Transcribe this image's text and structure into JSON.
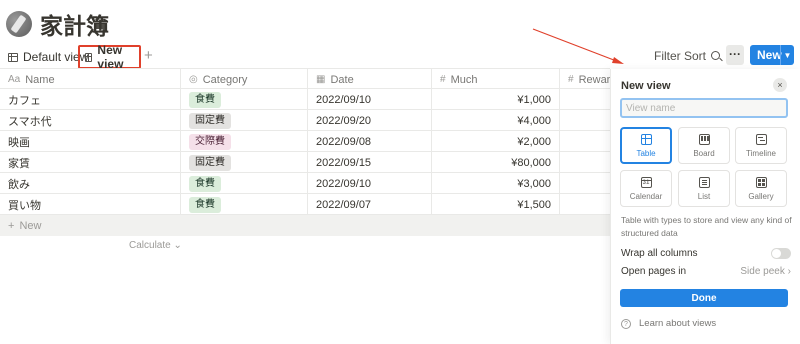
{
  "page": {
    "title": "家計簿"
  },
  "views": {
    "tabs": [
      {
        "label": "Default view"
      },
      {
        "label": "New view"
      }
    ],
    "filter_label": "Filter",
    "sort_label": "Sort",
    "more_label": "···",
    "new_label": "New"
  },
  "table": {
    "columns": [
      {
        "icon": "Aa",
        "label": "Name"
      },
      {
        "icon": "◎",
        "label": "Category"
      },
      {
        "icon": "▦",
        "label": "Date"
      },
      {
        "icon": "#",
        "label": "Much"
      },
      {
        "icon": "#",
        "label": "Reward"
      }
    ],
    "rows": [
      {
        "name": "カフェ",
        "category": "食費",
        "category_color": "#dbeddb",
        "date": "2022/09/10",
        "much": "¥1,000"
      },
      {
        "name": "スマホ代",
        "category": "固定費",
        "category_color": "#e3e2e0",
        "date": "2022/09/20",
        "much": "¥4,000"
      },
      {
        "name": "映画",
        "category": "交際費",
        "category_color": "#f5e0e9",
        "date": "2022/09/08",
        "much": "¥2,000"
      },
      {
        "name": "家賃",
        "category": "固定費",
        "category_color": "#e3e2e0",
        "date": "2022/09/15",
        "much": "¥80,000"
      },
      {
        "name": "飲み",
        "category": "食費",
        "category_color": "#dbeddb",
        "date": "2022/09/10",
        "much": "¥3,000"
      },
      {
        "name": "買い物",
        "category": "食費",
        "category_color": "#dbeddb",
        "date": "2022/09/07",
        "much": "¥1,500"
      }
    ],
    "new_row_label": "New",
    "calculate_label": "Calculate"
  },
  "new_view_panel": {
    "title": "New view",
    "close_icon": "×",
    "name_placeholder": "View name",
    "layouts": [
      {
        "label": "Table",
        "icon": "table-icon",
        "selected": true
      },
      {
        "label": "Board",
        "icon": "board-icon",
        "selected": false
      },
      {
        "label": "Timeline",
        "icon": "timeline-icon",
        "selected": false
      },
      {
        "label": "Calendar",
        "icon": "calendar-icon",
        "selected": false
      },
      {
        "label": "List",
        "icon": "list-icon",
        "selected": false
      },
      {
        "label": "Gallery",
        "icon": "gallery-icon",
        "selected": false
      }
    ],
    "calendar_icon_text": "31",
    "description": "Table with types to store and view any kind of structured data",
    "wrap_label": "Wrap all columns",
    "wrap_enabled": false,
    "open_pages_label": "Open pages in",
    "open_pages_value": "Side peek",
    "done_label": "Done",
    "learn_label": "Learn about views"
  },
  "colors": {
    "accent": "#2383e2",
    "highlight_box": "#e0402b"
  }
}
